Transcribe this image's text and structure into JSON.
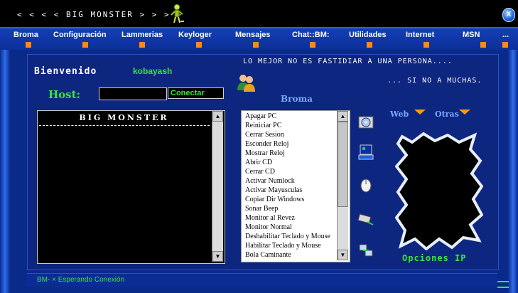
{
  "window": {
    "title": "< < < <  BIG  MONSTER  > > > >",
    "close_symbol": "X"
  },
  "menu": [
    {
      "label": "Broma"
    },
    {
      "label": "Configuración"
    },
    {
      "label": "Lammerias"
    },
    {
      "label": "Keyloger"
    },
    {
      "label": "Mensajes"
    },
    {
      "label": "Chat::BM:"
    },
    {
      "label": "Utilidades"
    },
    {
      "label": "Internet"
    },
    {
      "label": "MSN"
    }
  ],
  "welcome": {
    "greeting": "Bienvenido",
    "username": "kobayash"
  },
  "host": {
    "label": "Host:",
    "value": "",
    "connect_label": "Conectar"
  },
  "taglines": {
    "line1": "LO MEJOR NO ES FASTIDIAR  A UNA PERSONA....",
    "line2": "... SI NO A MUCHAS."
  },
  "log": {
    "title": "BIG MONSTER",
    "rule": "-------------------------------------------------------------"
  },
  "broma": {
    "title": "Broma",
    "commands": [
      "Apagar PC",
      "Reiniciar PC",
      "Cerrar Sesion",
      "Esconder Reloj",
      "Mostrar Reloj",
      "Abrir CD",
      "Cerrar CD",
      "Activar Numlock",
      "Activar Mayusculas",
      "Copiar Dir Windows",
      "Sonar Beep",
      "Monitor al Revez",
      "Monitor Normal",
      "Deshabilitar Teclado y Mouse",
      "Habilitar Teclado y Mouse",
      "Bola Caminante"
    ]
  },
  "tools": [
    "cd-drive-icon",
    "windows-desktop-icon",
    "mouse-icon",
    "keyboard-icon",
    "network-icon"
  ],
  "web_options": {
    "web_label": "Web",
    "otras_label": "Otras",
    "ip_label": "Opciones IP"
  },
  "status": {
    "text": "BM- × Esperando Conexión"
  },
  "colors": {
    "accent_green": "#38e838",
    "accent_orange": "#ff8a14",
    "background_blue": "#0d2680"
  }
}
